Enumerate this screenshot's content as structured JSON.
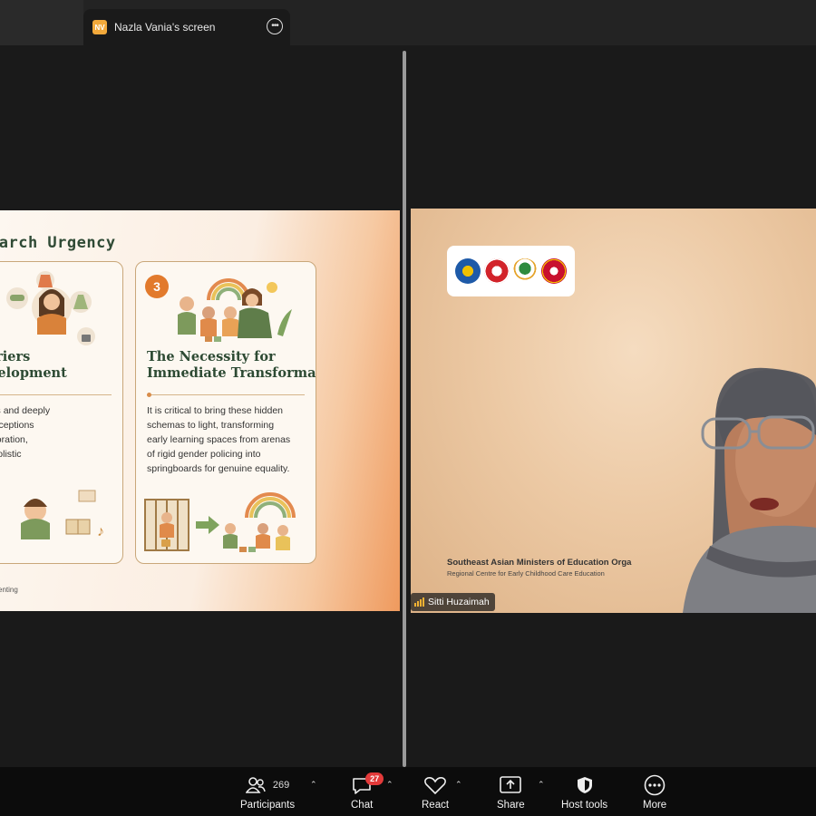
{
  "top_bar": {
    "presenter_initials": "NV",
    "share_title": "Nazla Vania's screen",
    "options_icon": "more-options-icon"
  },
  "slide": {
    "title": "earch Urgency",
    "card_2": {
      "heading": "en Barriers\nild Development",
      "body": "cious biases and deeply\nized misconceptions\nldren's exploration,\nining their holistic\nvelopment."
    },
    "card_3": {
      "number": "3",
      "heading": "The Necessity for\nImmediate Transformation",
      "body": "It is critical to bring these hidden\nschemas to light, transforming\nearly learning spaces from arenas\nof rigid gender policing into\nspringboards for genuine equality."
    },
    "footer": "enting"
  },
  "video": {
    "org_name": "Southeast Asian Ministers of Education Orga",
    "org_sub": "Regional Centre for Early Childhood Care Education",
    "participant_name": "Sitti Huzaimah"
  },
  "toolbar": {
    "participants_label": "Participants",
    "participants_count": "269",
    "chat_label": "Chat",
    "chat_badge": "27",
    "react_label": "React",
    "share_label": "Share",
    "host_tools_label": "Host tools",
    "more_label": "More"
  },
  "colors": {
    "accent_orange": "#e27a2c",
    "slide_green": "#2d4a33",
    "badge_red": "#e33a3a",
    "presenter_badge": "#f2a93b"
  }
}
